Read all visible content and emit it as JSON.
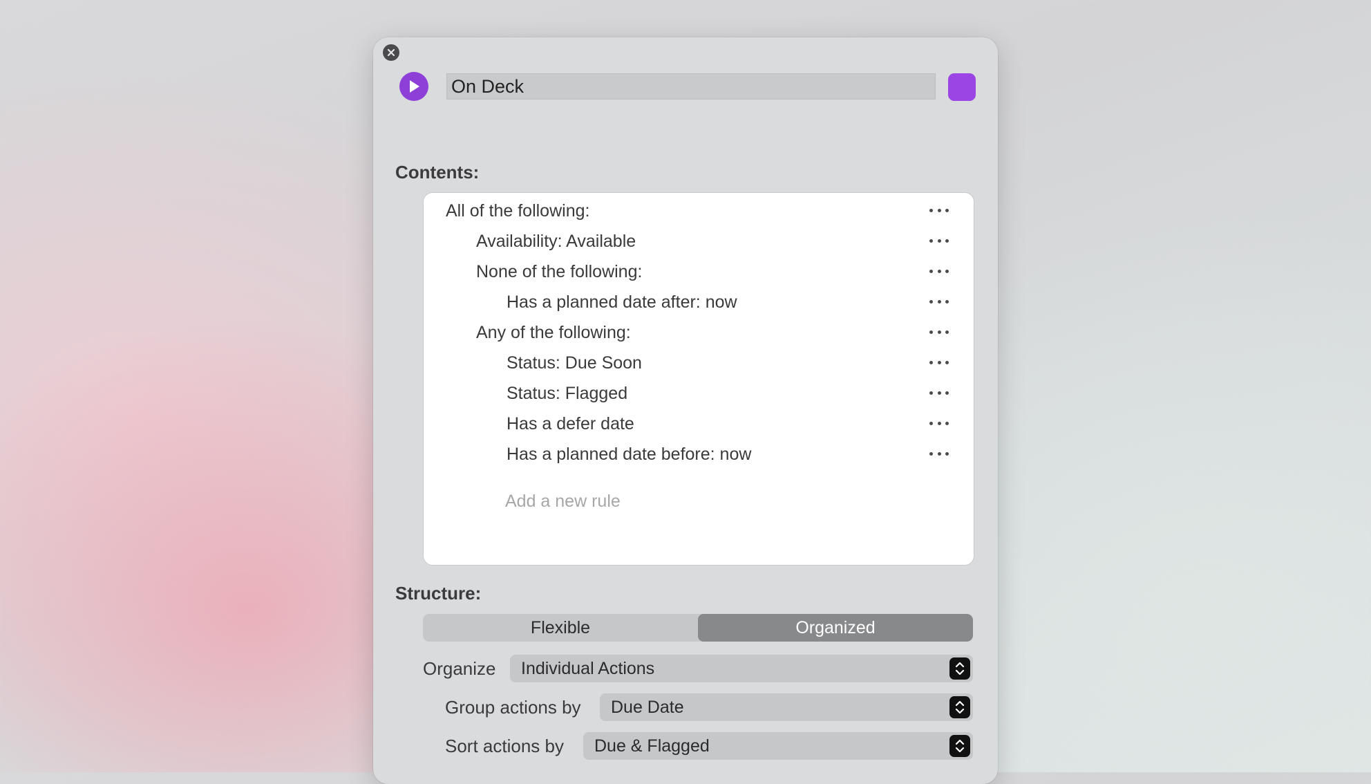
{
  "header": {
    "title_value": "On Deck",
    "accent_color": "#9b45e4"
  },
  "contents": {
    "label": "Contents:",
    "rules": [
      {
        "text": "All of the following:",
        "level": 0
      },
      {
        "text": "Availability: Available",
        "level": 1
      },
      {
        "text": "None of the following:",
        "level": 1
      },
      {
        "text": "Has a planned date after: now",
        "level": 2
      },
      {
        "text": "Any of the following:",
        "level": 1
      },
      {
        "text": "Status: Due Soon",
        "level": 2
      },
      {
        "text": "Status: Flagged",
        "level": 2
      },
      {
        "text": "Has a defer date",
        "level": 2
      },
      {
        "text": "Has a planned date before: now",
        "level": 2
      }
    ],
    "add_rule_placeholder": "Add a new rule"
  },
  "structure": {
    "label": "Structure:",
    "segments": [
      "Flexible",
      "Organized"
    ],
    "selected_segment": "Organized",
    "organize_label": "Organize",
    "organize_value": "Individual Actions",
    "group_label": "Group actions by",
    "group_value": "Due Date",
    "sort_label": "Sort actions by",
    "sort_value": "Due & Flagged"
  }
}
